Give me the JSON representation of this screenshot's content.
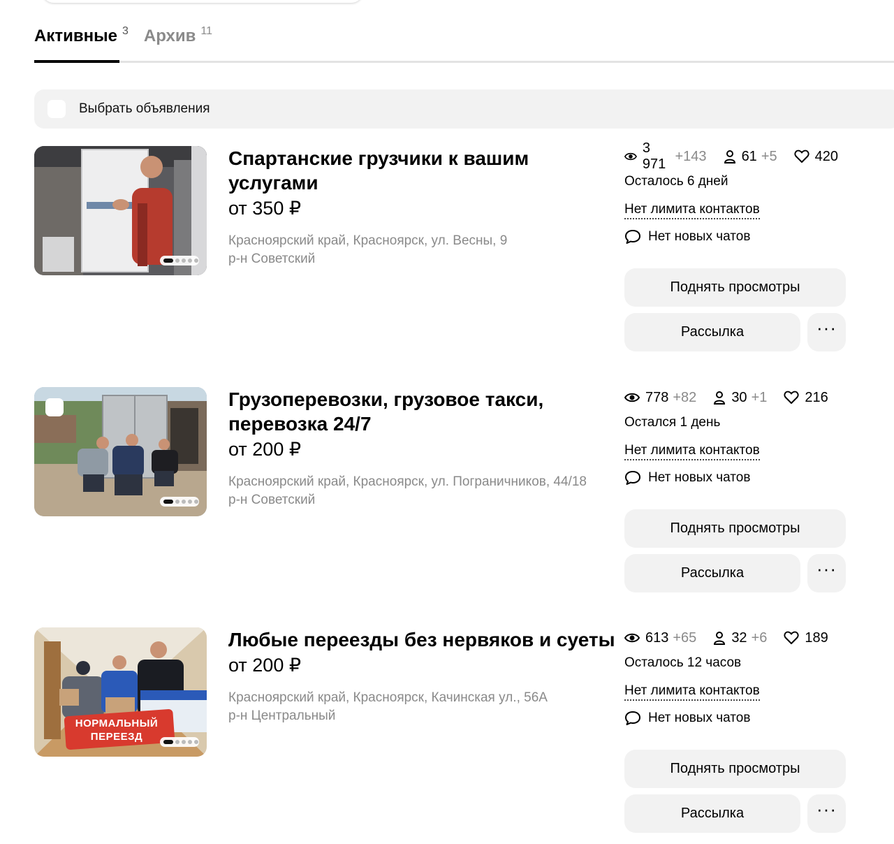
{
  "tabs": [
    {
      "label": "Активные",
      "count": "3"
    },
    {
      "label": "Архив",
      "count": "11"
    }
  ],
  "select_all_label": "Выбрать объявления",
  "listings": [
    {
      "title": "Спартанские грузчики к вашим услугами",
      "price": "от 350 ₽",
      "address": "Красноярский край, Красноярск, ул. Весны, 9",
      "district": "р-н Советский",
      "views": "3 971",
      "views_delta": "+143",
      "contacts": "61",
      "contacts_delta": "+5",
      "favorites": "420",
      "remaining": "Осталось 6 дней",
      "limit": "Нет лимита контактов",
      "chats": "Нет новых чатов",
      "raise_label": "Поднять просмотры",
      "mailing_label": "Рассылка",
      "more_label": "···",
      "photo_icon": "mover-with-fridge-photo"
    },
    {
      "title": "Грузоперевозки, грузовое такси, перевозка 24/7",
      "price": "от 200 ₽",
      "address": "Красноярский край, Красноярск, ул. Пограничников, 44/18",
      "district": "р-н Советский",
      "views": "778",
      "views_delta": "+82",
      "contacts": "30",
      "contacts_delta": "+1",
      "favorites": "216",
      "remaining": "Остался 1 день",
      "limit": "Нет лимита контактов",
      "chats": "Нет новых чатов",
      "raise_label": "Поднять просмотры",
      "mailing_label": "Рассылка",
      "more_label": "···",
      "photo_icon": "movers-carrying-cabinet-photo"
    },
    {
      "title": "Любые переезды без нервяков и суеты",
      "price": "от 200 ₽",
      "address": "Красноярский край, Красноярск, Качинская ул., 56А",
      "district": "р-н Центральный",
      "views": "613",
      "views_delta": "+65",
      "contacts": "32",
      "contacts_delta": "+6",
      "favorites": "189",
      "remaining": "Осталось 12 часов",
      "limit": "Нет лимита контактов",
      "chats": "Нет новых чатов",
      "raise_label": "Поднять просмотры",
      "mailing_label": "Рассылка",
      "more_label": "···",
      "photo_icon": "movers-in-corridor-photo",
      "photo_text": "НОРМАЛЬНЫЙ ПЕРЕЕЗД"
    }
  ]
}
